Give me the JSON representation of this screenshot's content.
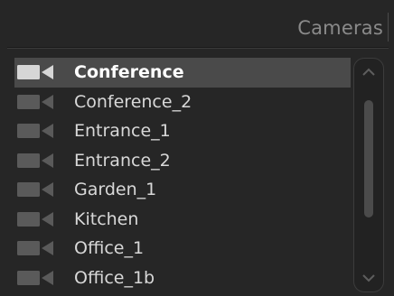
{
  "panel": {
    "title": "Cameras"
  },
  "cameras": {
    "selected_index": 0,
    "items": [
      {
        "label": "Conference",
        "icon": "video-camera-icon"
      },
      {
        "label": "Conference_2",
        "icon": "video-camera-icon"
      },
      {
        "label": "Entrance_1",
        "icon": "video-camera-icon"
      },
      {
        "label": "Entrance_2",
        "icon": "video-camera-icon"
      },
      {
        "label": "Garden_1",
        "icon": "video-camera-icon"
      },
      {
        "label": "Kitchen",
        "icon": "video-camera-icon"
      },
      {
        "label": "Office_1",
        "icon": "video-camera-icon"
      },
      {
        "label": "Office_1b",
        "icon": "video-camera-icon"
      }
    ]
  },
  "colors": {
    "background": "#262626",
    "selected_row": "#4a4a4a",
    "icon_selected": "#d6d6d6",
    "icon_default": "#5a5a5a",
    "text": "#d8d8d8"
  },
  "scrollbar": {
    "up_icon": "chevron-up-icon",
    "down_icon": "chevron-down-icon"
  }
}
